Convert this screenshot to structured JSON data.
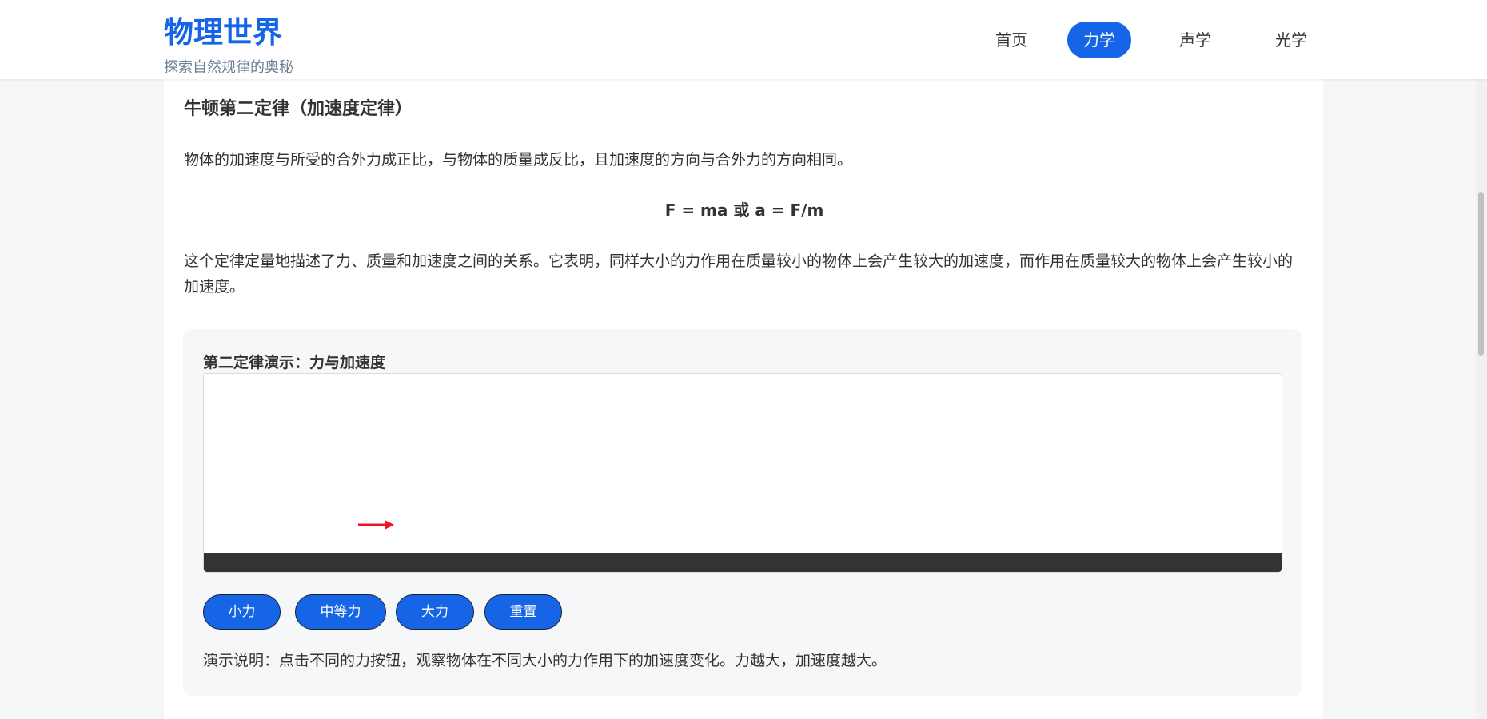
{
  "header": {
    "title": "物理世界",
    "subtitle": "探索自然规律的奥秘",
    "nav": [
      {
        "label": "首页",
        "active": false
      },
      {
        "label": "力学",
        "active": true
      },
      {
        "label": "声学",
        "active": false
      },
      {
        "label": "光学",
        "active": false
      }
    ]
  },
  "content": {
    "title": "牛顿第二定律（加速度定律）",
    "paragraph1": "物体的加速度与所受的合外力成正比，与物体的质量成反比，且加速度的方向与合外力的方向相同。",
    "formula": "F = ma 或 a = F/m",
    "paragraph2": "这个定律定量地描述了力、质量和加速度之间的关系。它表明，同样大小的力作用在质量较小的物体上会产生较大的加速度，而作用在质量较大的物体上会产生较小的加速度。"
  },
  "demo": {
    "title": "第二定律演示：力与加速度",
    "buttons": [
      "小力",
      "中等力",
      "大力",
      "重置"
    ],
    "note": "演示说明：点击不同的力按钮，观察物体在不同大小的力作用下的加速度变化。力越大，加速度越大。",
    "arrow_icon": "force-arrow-icon"
  },
  "colors": {
    "accent": "#1565e6",
    "arrow": "#e8151b",
    "ground": "#333333"
  }
}
